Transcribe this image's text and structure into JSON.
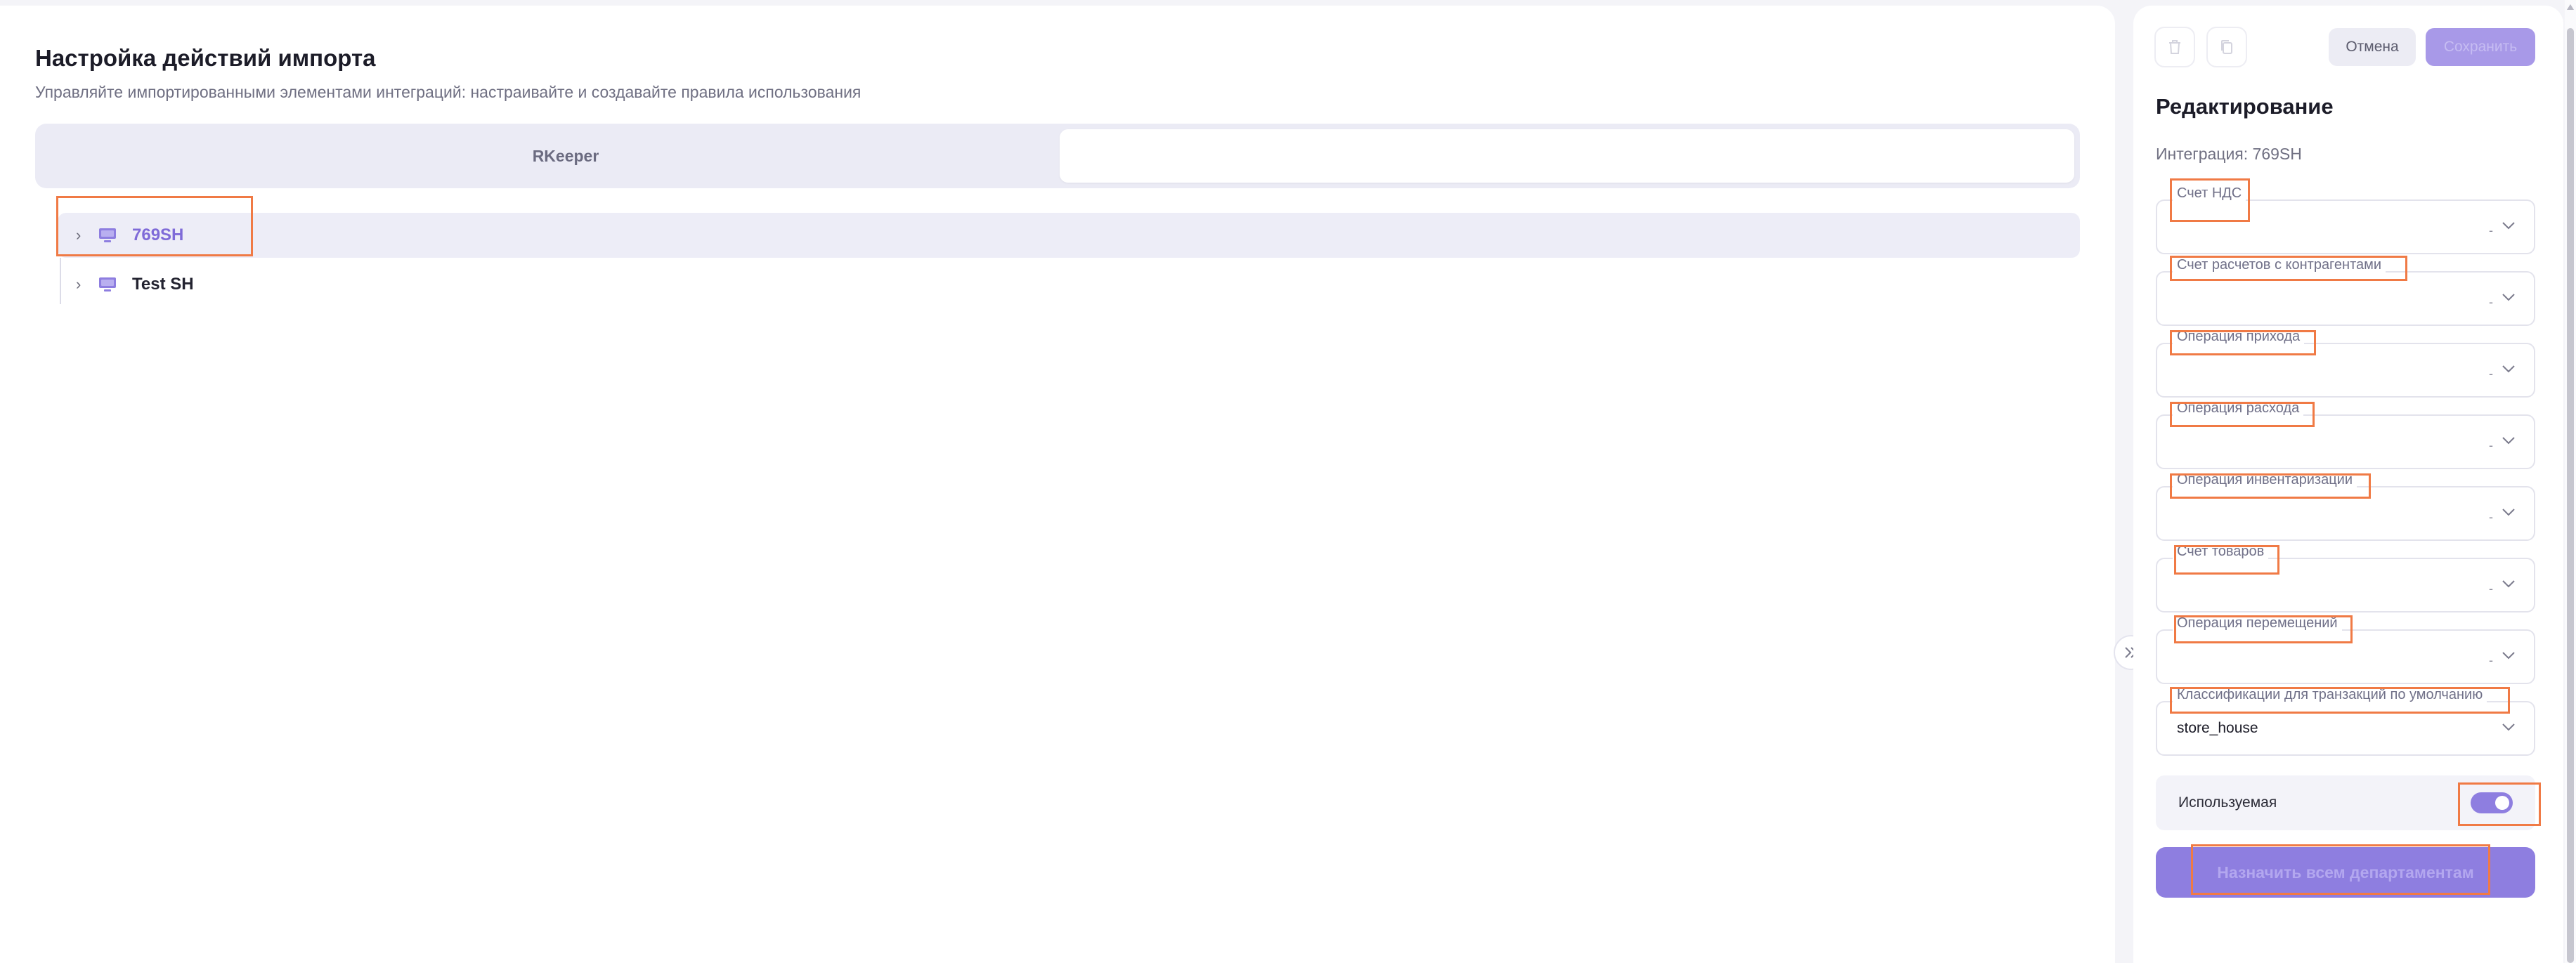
{
  "main": {
    "title": "Настройка действий импорта",
    "subtitle": "Управляйте импортированными элементами интеграций: настраивайте и создавайте правила использования",
    "tabs": [
      {
        "label": "RKeeper"
      },
      {
        "label": ""
      }
    ],
    "tree": [
      {
        "label": "769SH",
        "selected": true
      },
      {
        "label": "Test SH",
        "selected": false
      }
    ]
  },
  "edit_panel": {
    "cancel_label": "Отмена",
    "save_label": "Сохранить",
    "title": "Редактирование",
    "integration": "Интеграция: 769SH",
    "fields": [
      {
        "label": "Счет НДС",
        "value": ""
      },
      {
        "label": "Счет расчетов с контрагентами",
        "value": ""
      },
      {
        "label": "Операция прихода",
        "value": ""
      },
      {
        "label": "Операция расхода",
        "value": ""
      },
      {
        "label": "Операция инвентаризации",
        "value": ""
      },
      {
        "label": "Счет товаров",
        "value": ""
      },
      {
        "label": "Операция перемещений",
        "value": ""
      },
      {
        "label": "Классификации для транзакций по умолчанию",
        "value": "store_house"
      }
    ],
    "toggle": {
      "label": "Используемая",
      "on": true
    },
    "assign_label": "Назначить всем департаментам"
  },
  "colors": {
    "accent": "#8e7ee0",
    "accent_text": "#7f6bd8",
    "highlight": "#f07a45",
    "surface": "#ffffff",
    "background": "#f4f4f8"
  },
  "icons": {
    "tree_item": "monitor-icon",
    "collapse": "double-chevron-right-icon",
    "trash": "trash-icon",
    "copy": "copy-icon"
  }
}
